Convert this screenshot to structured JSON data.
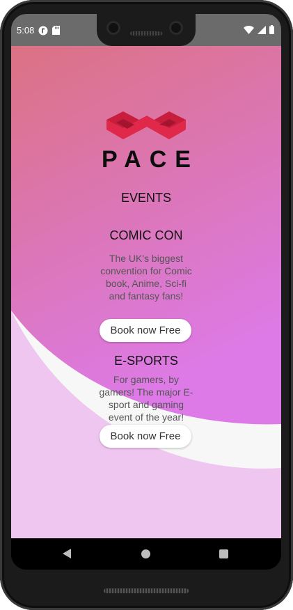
{
  "status_bar": {
    "time": "5:08",
    "icons": [
      "app-notification-icon",
      "sd-card-icon",
      "wifi-icon",
      "signal-icon",
      "battery-icon"
    ]
  },
  "app": {
    "brand": "PACE",
    "section_title": "EVENTS",
    "events": [
      {
        "title": "COMIC CON",
        "description": "The UK's biggest convention for Comic book, Anime, Sci-fi and fantasy fans!",
        "button_label": "Book now Free"
      },
      {
        "title": "E-SPORTS",
        "description": "For gamers, by gamers! The major E-sport and gaming event of the year!",
        "button_label": "Book now Free"
      }
    ]
  },
  "colors": {
    "gradient_top": "#db7283",
    "gradient_bottom": "#dd7ae8",
    "logo_red": "#e0284a",
    "background": "#f7f7f7"
  },
  "nav_bar": {
    "icons": [
      "back-icon",
      "home-icon",
      "recents-icon"
    ]
  }
}
